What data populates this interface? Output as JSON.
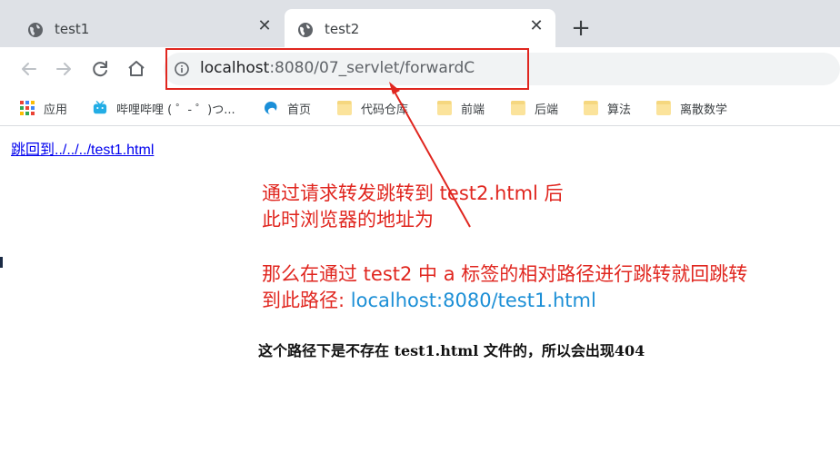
{
  "tabs": [
    {
      "title": "test1",
      "active": false
    },
    {
      "title": "test2",
      "active": true
    }
  ],
  "icons": {
    "tab_icon": "globe-icon",
    "close": "close-icon",
    "new_tab": "plus-icon",
    "back": "arrow-left-icon",
    "forward": "arrow-right-icon",
    "reload": "reload-icon",
    "home": "home-icon",
    "site_info": "info-icon",
    "apps": "apps-grid-icon",
    "bilibili": "bilibili-icon",
    "home_page": "edge-icon",
    "folder": "folder-icon"
  },
  "toolbar": {
    "url_host": "localhost",
    "url_rest": ":8080/07_servlet/forwardC"
  },
  "bookmarks": [
    {
      "label": "应用",
      "icon": "apps-grid-icon"
    },
    {
      "label": "哔哩哔哩 ( ゜- ゜)つ...",
      "icon": "bilibili-icon"
    },
    {
      "label": "首页",
      "icon": "edge-icon"
    },
    {
      "label": "代码仓库",
      "icon": "folder-icon"
    },
    {
      "label": "前端",
      "icon": "folder-icon"
    },
    {
      "label": "后端",
      "icon": "folder-icon"
    },
    {
      "label": "算法",
      "icon": "folder-icon"
    },
    {
      "label": "离散数学",
      "icon": "folder-icon"
    }
  ],
  "page": {
    "link_text": "跳回到../../../test1.html"
  },
  "annotations": {
    "note1_line1": "通过请求转发跳转到 test2.html 后",
    "note1_line2": "此时浏览器的地址为",
    "note2_line1": "那么在通过 test2 中 a 标签的相对路径进行跳转就回跳转",
    "note2_line2_prefix": "到此路径: ",
    "note2_line2_url": "localhost:8080/test1.html",
    "note3": "这个路径下是不存在 test1.html 文件的，所以会出现404"
  },
  "colors": {
    "annotation_red": "#e0261f",
    "annotation_blue": "#1c8fd6",
    "link_blue": "#0000ee",
    "tabstrip_bg": "#dee1e6",
    "omnibox_bg": "#f1f3f4"
  }
}
